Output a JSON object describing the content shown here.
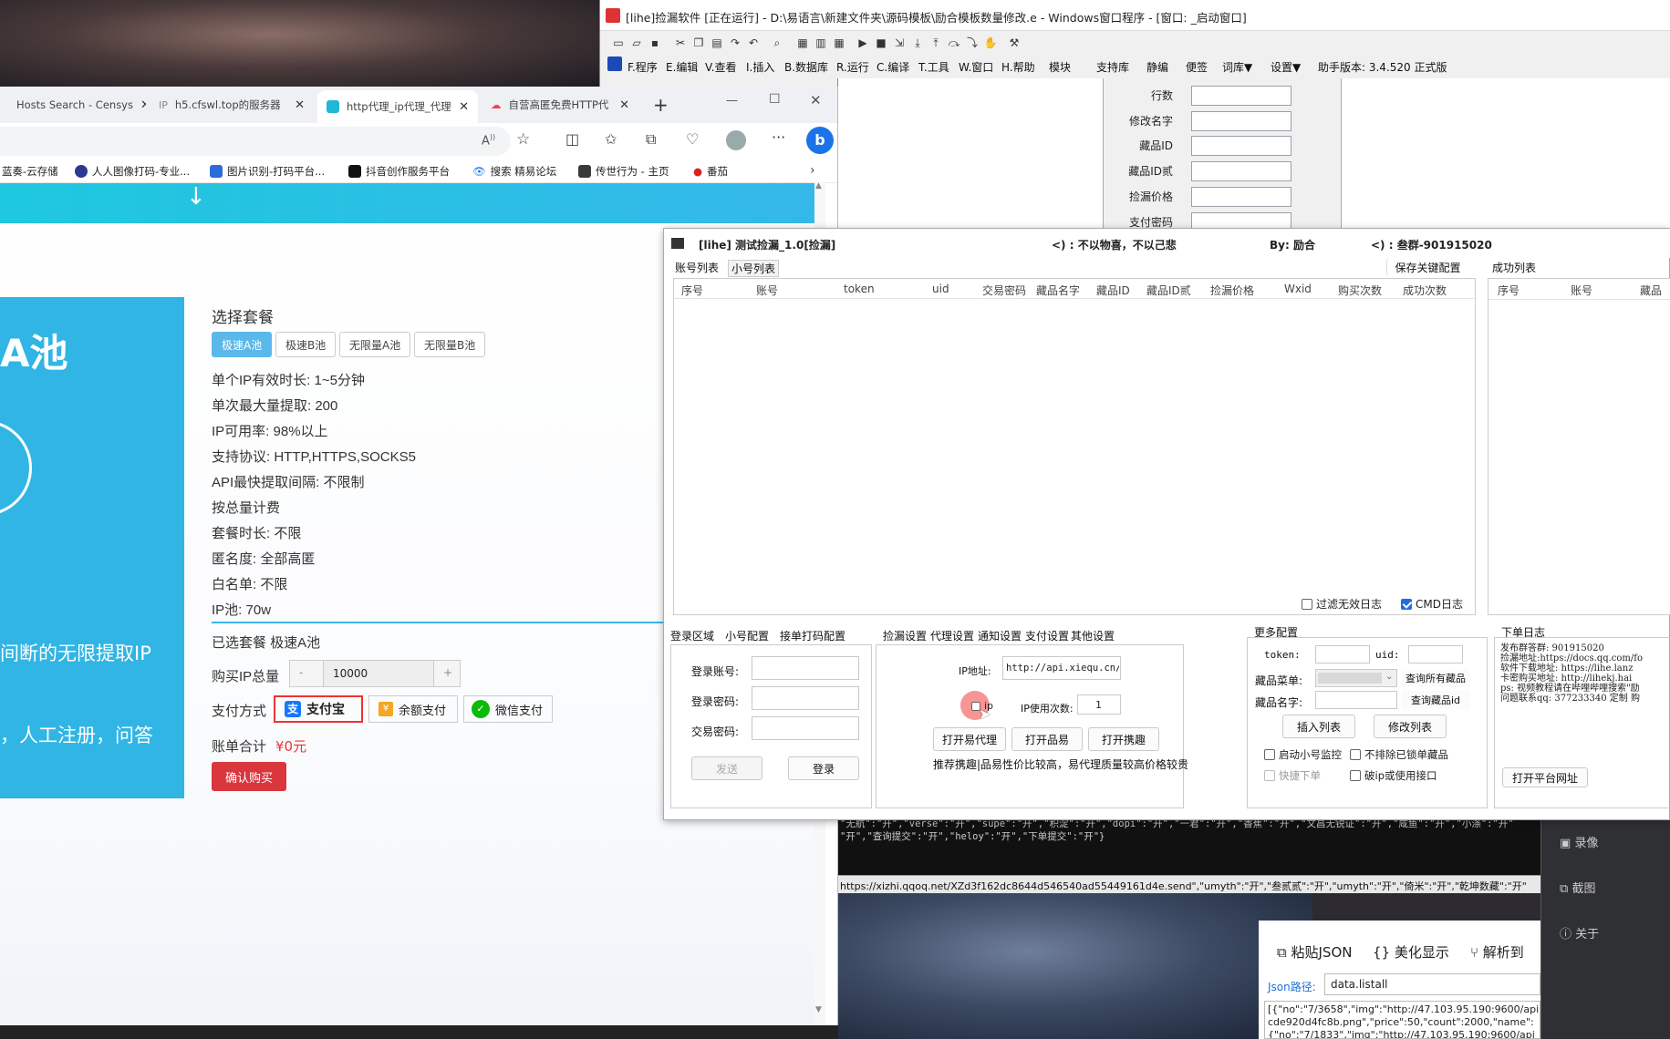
{
  "editor": {
    "title": "[lihe]捡漏软件 [正在运行] - D:\\易语言\\新建文件夹\\源码模板\\励合模板数量修改.e - Windows窗口程序 - [窗口: _启动窗口]",
    "menus": [
      "F.程序",
      "E.编辑",
      "V.查看",
      "I.插入",
      "B.数据库",
      "R.运行",
      "C.编译",
      "T.工具",
      "W.窗口",
      "H.帮助",
      "模块",
      "支持库",
      "静编",
      "便签",
      "词库▼",
      "设置▼",
      "助手版本: 3.4.520 正式版"
    ],
    "form_labels": [
      "行数",
      "修改名字",
      "藏品ID",
      "藏品ID贰",
      "捡漏价格",
      "支付密码"
    ]
  },
  "browser": {
    "tabs": [
      "Hosts Search - Censys",
      "h5.cfswl.top的服务器",
      "http代理_ip代理_代理",
      "自营高匿免费HTTP代"
    ],
    "tab_close": "✕",
    "new_tab": "+",
    "bookmarks": [
      "蓝奏-云存储",
      "人人图像打码-专业...",
      "图片识别-打码平台...",
      "抖音创作服务平台",
      "搜索 精易论坛",
      "传世行为 - 主页",
      "番茄"
    ],
    "win_controls": [
      "—",
      "☐",
      "✕"
    ],
    "hero_text": "A池",
    "hero_line1": "间断的无限提取IP",
    "hero_line2": "，人工注册，问答",
    "select_title": "选择套餐",
    "packages": [
      "极速A池",
      "极速B池",
      "无限量A池",
      "无限量B池"
    ],
    "info_lines": [
      "单个IP有效时长: 1~5分钟",
      "单次最大量提取: 200",
      "IP可用率: 98%以上",
      "支持协议: HTTP,HTTPS,SOCKS5",
      "API最快提取间隔: 不限制",
      "按总量计费",
      "套餐时长: 不限",
      "匿名度: 全部高匿",
      "白名单: 不限",
      "IP池: 70w"
    ],
    "selected_pkg": "已选套餐 极速A池",
    "buy_label": "购买IP总量",
    "qty": "10000",
    "minus": "-",
    "plus": "+",
    "pay_label": "支付方式",
    "pay_options": [
      "支付宝",
      "余额支付",
      "微信支付"
    ],
    "total_label": "账单合计",
    "total_value": "¥0元",
    "confirm": "确认购买"
  },
  "tool": {
    "title": "[lihe] 测试捡漏_1.0[捡漏]",
    "motto": "<) : 不以物喜，不以己悲",
    "by": "By: 励合",
    "group": "<) : 叁群-901915020",
    "tabs_top": [
      "账号列表",
      "小号列表"
    ],
    "save_btn": "保存关键配置",
    "success_tab": "成功列表",
    "columns": [
      "序号",
      "账号",
      "token",
      "uid",
      "交易密码",
      "藏品名字",
      "藏品ID",
      "藏品ID贰",
      "捡漏价格",
      "Wxid",
      "购买次数",
      "成功次数"
    ],
    "success_columns": [
      "序号",
      "账号",
      "藏品"
    ],
    "filter_log": "过滤无效日志",
    "cmd_log": "CMD日志",
    "bottom_tabs_left": [
      "登录区域",
      "小号配置",
      "接单打码配置"
    ],
    "login_labels": [
      "登录账号:",
      "登录密码:",
      "交易密码:"
    ],
    "send_btn": "发送",
    "login_btn": "登录",
    "bottom_tabs_mid": [
      "捡漏设置",
      "代理设置",
      "通知设置",
      "支付设置",
      "其他设置"
    ],
    "ip_label": "IP地址:",
    "ip_value": "http://api.xiequ.cn/V",
    "use_ip": "ip",
    "ip_count_label": "IP使用次数:",
    "ip_count": "1",
    "proxy_btns": [
      "打开易代理",
      "打开品易",
      "打开携趣"
    ],
    "proxy_note": "推荐携趣|品易性价比较高，易代理质量较高价格较贵",
    "more_config": "更多配置",
    "token_label": "token:",
    "uid_label": "uid:",
    "menu_label": "藏品菜单:",
    "query_all": "查询所有藏品",
    "name_label": "藏品名字:",
    "query_id": "查询藏品id",
    "insert_btn": "插入列表",
    "modify_btn": "修改列表",
    "checks": [
      "启动小号监控",
      "不排除已锁单藏品",
      "快捷下单",
      "破ip或使用接口"
    ],
    "order_log": "下单日志",
    "log_lines": [
      "发布群答群: 901915020",
      "捡漏地址:https://docs.qq.com/fo",
      "软件下载地址: https://lihe.lanz",
      "卡密购买地址: http://lihekj.hai",
      "ps: 视频教程请在哔哩哔哩搜索\"励",
      "问题联系qq: 377233340  定制 购"
    ],
    "open_platform": "打开平台网址"
  },
  "console": {
    "line1": "\"无航\":\"开\",\"verse\":\"开\",\"supe\":\"开\",\"积淀\":\"开\",\"dopi\":\"开\",\"一君\":\"开\",\"香蕉\":\"开\",\"文昌无锐证\":\"开\",\"咸鱼\":\"开\",\"小涤\":\"开\"",
    "line2": "\"开\",\"查询提交\":\"开\",\"heloy\":\"开\",\"下单提交\":\"开\"}",
    "url": "https://xizhi.qqoq.net/XZd3f162dc8644d546540ad55449161d4e.send\",\"umyth\":\"开\",\"叁贰贰\":\"开\",\"umyth\":\"开\",\"倚米\":\"开\",\"乾坤数藏\":\"开\""
  },
  "json_tool": {
    "paste": "粘贴JSON",
    "beautify": "美化显示",
    "parse": "解析到",
    "path_label": "Json路径:",
    "path_value": "data.listall",
    "output1": "[{\"no\":\"7/3658\",\"img\":\"http://47.103.95.190:9600/api",
    "output2": "cde920d4fc8b.png\",\"price\":50,\"count\":2000,\"name\":",
    "output3": "{\"no\":\"7/1833\",\"img\":\"http://47.103.95.190:9600/api"
  },
  "side_panel": [
    "录像",
    "截图",
    "关于"
  ]
}
